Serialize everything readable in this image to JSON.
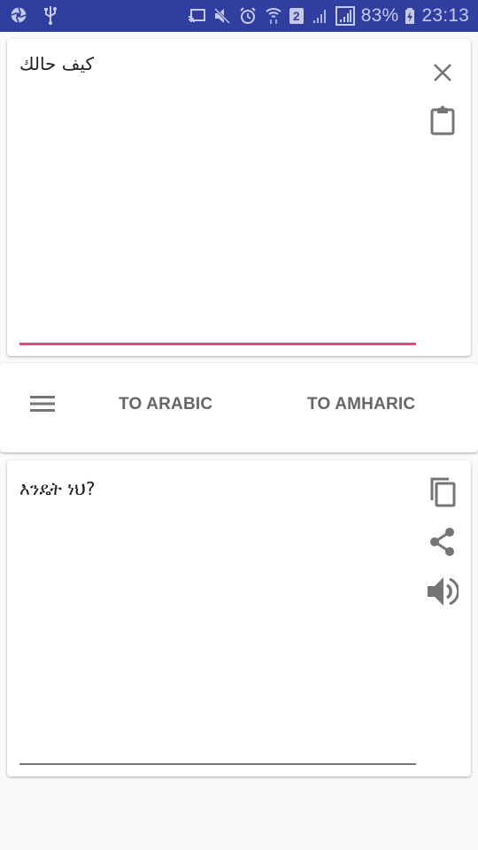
{
  "status_bar": {
    "left_icons": [
      "camera-aperture-icon",
      "usb-icon"
    ],
    "right_icons": [
      "cast-icon",
      "mute-icon",
      "alarm-icon",
      "wifi-icon",
      "sim2-icon",
      "signal-weak-icon",
      "signal-icon"
    ],
    "sim_label": "2",
    "battery": "83%",
    "time": "23:13"
  },
  "input_card": {
    "text": "كيف حالك",
    "underline_color": "#e5487a",
    "actions": [
      "close-icon",
      "paste-clipboard-icon"
    ]
  },
  "toolbar": {
    "menu_icon": "hamburger-menu-icon",
    "to_arabic_label": "TO ARABIC",
    "to_amharic_label": "TO AMHARIC"
  },
  "output_card": {
    "text": "እንዴት ነህ?",
    "actions": [
      "copy-icon",
      "share-icon",
      "speaker-icon"
    ]
  },
  "colors": {
    "status_bar": "#303f9f",
    "accent": "#e5487a",
    "icon_gray": "#757575",
    "background": "#fafafa"
  }
}
